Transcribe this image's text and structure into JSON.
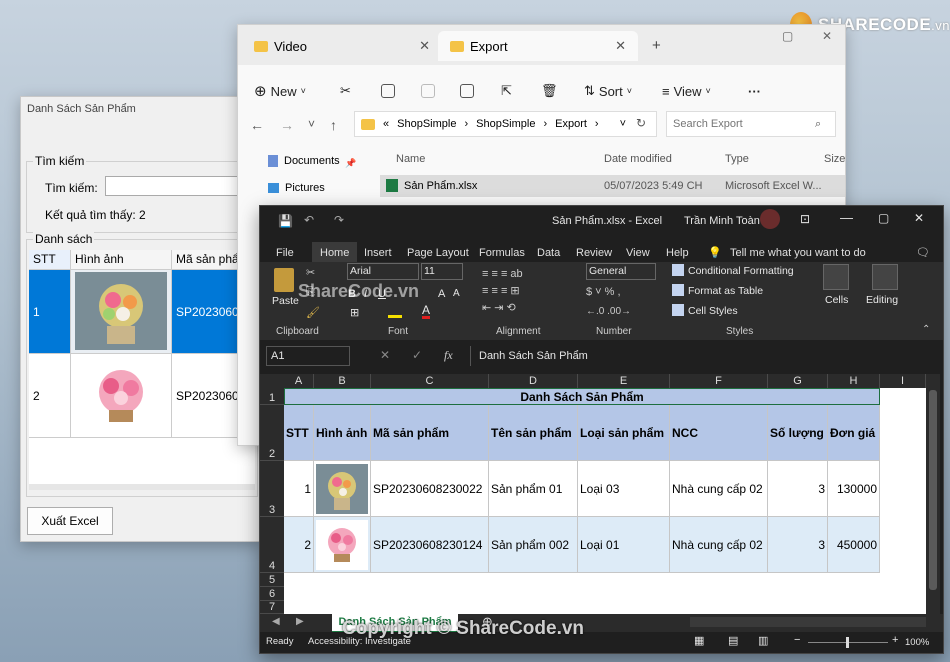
{
  "watermark": {
    "brand": "SHARECODE",
    "suffix": ".vn",
    "bottom": "Copyright © ShareCode.vn",
    "mid": "ShareCode.vn"
  },
  "winform": {
    "title": "Danh Sách Sản Phẩm",
    "search_group": "Tìm kiếm",
    "search_label": "Tìm kiếm:",
    "search_value": "",
    "result_text": "Kết quả tìm thấy: 2",
    "list_group": "Danh sách",
    "columns": [
      "STT",
      "Hình ảnh",
      "Mã sản phẩ"
    ],
    "rows": [
      {
        "stt": "1",
        "code": "SP2023060"
      },
      {
        "stt": "2",
        "code": "SP2023060"
      }
    ],
    "export_button": "Xuất Excel"
  },
  "explorer": {
    "tabs": [
      "Video",
      "Export"
    ],
    "toolbar": {
      "new": "New",
      "sort": "Sort",
      "view": "View"
    },
    "breadcrumb": [
      "«",
      "ShopSimple",
      "ShopSimple",
      "Export"
    ],
    "search_placeholder": "Search Export",
    "nav": [
      "Documents",
      "Pictures"
    ],
    "headers": [
      "Name",
      "Date modified",
      "Type",
      "Size"
    ],
    "file": {
      "name": "Sản Phẩm.xlsx",
      "date": "05/07/2023 5:49 CH",
      "type": "Microsoft Excel W..."
    }
  },
  "excel": {
    "title": "Sản Phẩm.xlsx  -  Excel",
    "user": "Trần Minh Toàn",
    "menu": [
      "File",
      "Home",
      "Insert",
      "Page Layout",
      "Formulas",
      "Data",
      "Review",
      "View",
      "Help"
    ],
    "tell_me": "Tell me what you want to do",
    "ribbon": {
      "paste": "Paste",
      "font_name": "Arial",
      "font_size": "11",
      "number_format": "General",
      "cond_format": "Conditional Formatting",
      "format_table": "Format as Table",
      "cell_styles": "Cell Styles",
      "cells": "Cells",
      "editing": "Editing",
      "groups": [
        "Clipboard",
        "Font",
        "Alignment",
        "Number",
        "Styles"
      ]
    },
    "name_box": "A1",
    "formula": "Danh Sách Sản Phẩm",
    "columns": [
      "A",
      "B",
      "C",
      "D",
      "E",
      "F",
      "G",
      "H",
      "I"
    ],
    "row_numbers": [
      "1",
      "2",
      "3",
      "4",
      "5",
      "6",
      "7"
    ],
    "sheet_title": "Danh Sách Sản Phẩm",
    "headers": [
      "STT",
      "Hình ảnh",
      "Mã sản phẩm",
      "Tên sản phẩm",
      "Loại sản phẩm",
      "NCC",
      "Số lượng",
      "Đơn giá"
    ],
    "rows": [
      {
        "stt": "1",
        "code": "SP20230608230022",
        "name": "Sản phẩm 01",
        "type": "Loại 03",
        "ncc": "Nhà cung cấp 02",
        "qty": "3",
        "price": "130000"
      },
      {
        "stt": "2",
        "code": "SP20230608230124",
        "name": "Sản phẩm 002",
        "type": "Loại 01",
        "ncc": "Nhà cung cấp 02",
        "qty": "3",
        "price": "450000"
      }
    ],
    "sheet_tab": "Danh Sách Sản Phẩm",
    "status": {
      "ready": "Ready",
      "accessibility": "Accessibility: Investigate",
      "zoom": "100%"
    }
  }
}
